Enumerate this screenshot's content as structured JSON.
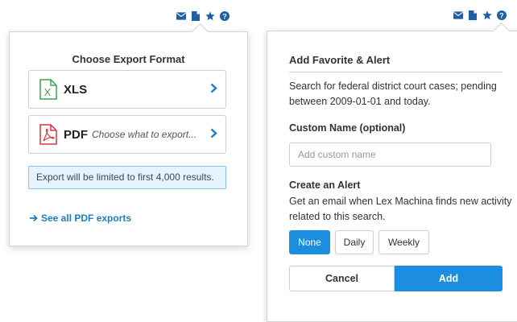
{
  "export": {
    "title": "Choose Export Format",
    "formats": [
      {
        "label": "XLS",
        "hint": "",
        "icon": "xls-file-icon",
        "color": "#3aa64a"
      },
      {
        "label": "PDF",
        "hint": "Choose what to export...",
        "icon": "pdf-file-icon",
        "color": "#d8373a"
      }
    ],
    "notice": "Export will be limited to first 4,000 results.",
    "see_all": "See all PDF exports"
  },
  "alert": {
    "title": "Add Favorite & Alert",
    "description": "Search for federal district court cases; pending between 2009-01-01 and today.",
    "custom_name_label": "Custom Name (optional)",
    "custom_name_placeholder": "Add custom name",
    "custom_name_value": "",
    "create_label": "Create an Alert",
    "create_description": "Get an email when Lex Machina finds new activity related to this search.",
    "frequency_options": [
      "None",
      "Daily",
      "Weekly"
    ],
    "frequency_selected": "None",
    "cancel_label": "Cancel",
    "add_label": "Add"
  },
  "toolbar_icons": [
    "envelope-icon",
    "document-icon",
    "star-icon",
    "help-icon"
  ],
  "colors": {
    "accent": "#1c8ee0",
    "icon_blue": "#1f5fa8",
    "notice_bg": "#e4f3fc"
  }
}
